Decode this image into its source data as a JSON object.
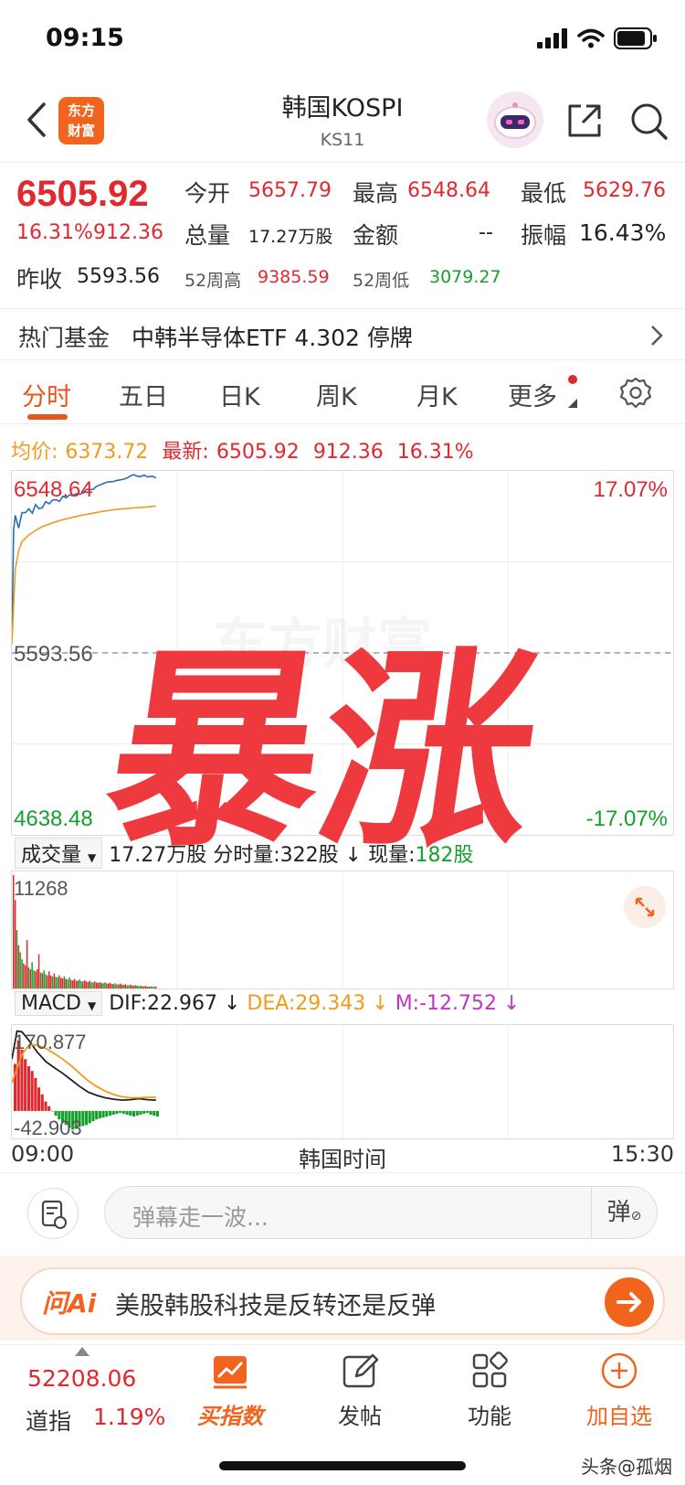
{
  "status_bar": {
    "time": "09:15"
  },
  "nav": {
    "logo_text_1": "东方",
    "logo_text_2": "财富",
    "title": "韩国KOSPI",
    "code": "KS11"
  },
  "quote": {
    "price": "6505.92",
    "change_pct": "16.31%",
    "change": "912.36",
    "open_label": "今开",
    "open": "5657.79",
    "high_label": "最高",
    "high": "6548.64",
    "low_label": "最低",
    "low": "5629.76",
    "volume_label": "总量",
    "volume": "17.27万股",
    "amount_label": "金额",
    "amount": "--",
    "amplitude_label": "振幅",
    "amplitude": "16.43%",
    "prev_close_label": "昨收",
    "prev_close": "5593.56",
    "w52_high_label": "52周高",
    "w52_high": "9385.59",
    "w52_low_label": "52周低",
    "w52_low": "3079.27"
  },
  "fund": {
    "label": "热门基金",
    "text": "中韩半导体ETF 4.302 停牌"
  },
  "tabs": [
    {
      "label": "分时"
    },
    {
      "label": "五日"
    },
    {
      "label": "日K"
    },
    {
      "label": "周K"
    },
    {
      "label": "月K"
    },
    {
      "label": "更多"
    }
  ],
  "info_line": {
    "avg_label": "均价:",
    "avg": "6373.72",
    "latest_label": "最新:",
    "latest": "6505.92",
    "change": "912.36",
    "pct": "16.31%"
  },
  "overlay_text": "暴涨",
  "watermark_text": "东方财富",
  "chart_data": [
    {
      "type": "line",
      "name": "分时",
      "y_labels": {
        "top": "6548.64",
        "middle": "5593.56",
        "bottom": "4638.48"
      },
      "pct_labels": {
        "top": "17.07%",
        "bottom": "-17.07%"
      },
      "ylim": [
        4638.48,
        6548.64
      ],
      "baseline": 5593.56,
      "x_range_minutes": [
        0,
        390
      ],
      "series": [
        {
          "name": "最新",
          "color": "#2a6cb8",
          "points": [
            [
              0,
              5657.8
            ],
            [
              1,
              6250
            ],
            [
              2,
              6330
            ],
            [
              4,
              6262
            ],
            [
              6,
              6345
            ],
            [
              8,
              6345
            ],
            [
              10,
              6365
            ],
            [
              12,
              6342
            ],
            [
              14,
              6388
            ],
            [
              16,
              6366
            ],
            [
              18,
              6372
            ],
            [
              20,
              6404
            ],
            [
              22,
              6392
            ],
            [
              24,
              6412
            ],
            [
              26,
              6414
            ],
            [
              28,
              6404
            ],
            [
              30,
              6432
            ],
            [
              32,
              6424
            ],
            [
              34,
              6440
            ],
            [
              36,
              6436
            ],
            [
              38,
              6446
            ],
            [
              40,
              6443
            ],
            [
              42,
              6450
            ],
            [
              44,
              6470
            ],
            [
              46,
              6468
            ],
            [
              48,
              6470
            ],
            [
              50,
              6486
            ],
            [
              52,
              6494
            ],
            [
              54,
              6500
            ],
            [
              56,
              6508
            ],
            [
              58,
              6510
            ],
            [
              60,
              6512
            ],
            [
              62,
              6518
            ],
            [
              64,
              6520
            ],
            [
              66,
              6524
            ],
            [
              68,
              6530
            ],
            [
              70,
              6542
            ],
            [
              72,
              6548
            ],
            [
              74,
              6540
            ],
            [
              76,
              6538
            ],
            [
              78,
              6546
            ],
            [
              80,
              6536
            ],
            [
              83,
              6540
            ],
            [
              85,
              6530
            ]
          ]
        },
        {
          "name": "均价",
          "color": "#f29a1c",
          "points": [
            [
              0,
              5640
            ],
            [
              2,
              6040
            ],
            [
              4,
              6140
            ],
            [
              6,
              6190
            ],
            [
              10,
              6225
            ],
            [
              14,
              6250
            ],
            [
              18,
              6270
            ],
            [
              24,
              6290
            ],
            [
              30,
              6307
            ],
            [
              36,
              6320
            ],
            [
              42,
              6332
            ],
            [
              48,
              6342
            ],
            [
              54,
              6352
            ],
            [
              60,
              6360
            ],
            [
              66,
              6366
            ],
            [
              72,
              6370
            ],
            [
              78,
              6374
            ],
            [
              85,
              6380
            ]
          ]
        }
      ]
    },
    {
      "type": "bar",
      "name": "成交量",
      "label": "成交量",
      "total": "17.27万股",
      "period_label": "分时量:",
      "period": "322股",
      "current_label": "现量:",
      "current": "182股",
      "ymax_label": "11268",
      "ylim": [
        0,
        11268
      ],
      "values": [
        11268,
        8800,
        5800,
        4300,
        3600,
        2900,
        2500,
        2300,
        4800,
        2100,
        1900,
        2600,
        1800,
        1700,
        1900,
        3400,
        1600,
        1500,
        1800,
        1400,
        1300,
        1700,
        1300,
        1200,
        1500,
        1150,
        1100,
        1300,
        1050,
        1000,
        1200,
        950,
        900,
        1100,
        850,
        800,
        950,
        780,
        760,
        900,
        720,
        700,
        820,
        680,
        650,
        760,
        620,
        600,
        700,
        580,
        560,
        640,
        540,
        520,
        600,
        500,
        480,
        560,
        460,
        440,
        520,
        420,
        400,
        480,
        380,
        360,
        430,
        340,
        320,
        380,
        300,
        280,
        340,
        260,
        240,
        300,
        220,
        200,
        260,
        190,
        180,
        220,
        170,
        160,
        200
      ],
      "colors_pattern": [
        "#e0282e",
        "#e0282e",
        "#16a02b",
        "#e0282e",
        "#16a02b",
        "#16a02b",
        "#e0282e"
      ]
    },
    {
      "type": "line",
      "name": "MACD",
      "label": "MACD",
      "dif": "DIF:22.967",
      "dea": "DEA:29.343",
      "m": "M:-12.752",
      "ymax_label": "170.877",
      "ymin_label": "-42.903",
      "ylim": [
        -42.903,
        170.877
      ],
      "series": [
        {
          "name": "DIF",
          "color": "#222222",
          "points": [
            [
              0,
              110
            ],
            [
              3,
              170
            ],
            [
              6,
              168
            ],
            [
              10,
              150
            ],
            [
              15,
              125
            ],
            [
              20,
              105
            ],
            [
              25,
              92
            ],
            [
              30,
              80
            ],
            [
              35,
              66
            ],
            [
              40,
              52
            ],
            [
              45,
              40
            ],
            [
              50,
              33
            ],
            [
              55,
              28
            ],
            [
              60,
              25
            ],
            [
              65,
              23
            ],
            [
              70,
              24
            ],
            [
              75,
              26
            ],
            [
              80,
              24
            ],
            [
              85,
              23
            ]
          ]
        },
        {
          "name": "DEA",
          "color": "#f29a1c",
          "points": [
            [
              0,
              60
            ],
            [
              3,
              90
            ],
            [
              6,
              120
            ],
            [
              10,
              140
            ],
            [
              15,
              140
            ],
            [
              20,
              133
            ],
            [
              25,
              122
            ],
            [
              30,
              110
            ],
            [
              35,
              96
            ],
            [
              40,
              80
            ],
            [
              45,
              64
            ],
            [
              50,
              52
            ],
            [
              55,
              42
            ],
            [
              60,
              35
            ],
            [
              65,
              30
            ],
            [
              70,
              28
            ],
            [
              75,
              28
            ],
            [
              80,
              29
            ],
            [
              85,
              29
            ]
          ]
        }
      ],
      "m_bars": [
        100,
        150,
        130,
        110,
        95,
        85,
        70,
        50,
        35,
        20,
        10,
        0,
        -10,
        -18,
        -24,
        -30,
        -36,
        -40,
        -38,
        -34,
        -32,
        -30,
        -26,
        -22,
        -18,
        -16,
        -14,
        -12,
        -10,
        -8,
        -6,
        -4,
        -6,
        -8,
        -10,
        -12,
        -10,
        -8,
        -6,
        -4,
        -8,
        -10,
        -12
      ]
    }
  ],
  "time_axis": {
    "start": "09:00",
    "middle": "韩国时间",
    "end": "15:30"
  },
  "comment": {
    "placeholder": "弹幕走一波...",
    "danmaku_label": "弹"
  },
  "ai_bar": {
    "logo": "问Ai",
    "text": "美股韩股科技是反转还是反弹"
  },
  "bottom_nav": {
    "dow_value": "52208.06",
    "dow_name": "道指",
    "dow_pct": "1.19%",
    "items": [
      {
        "label": "买指数"
      },
      {
        "label": "发帖"
      },
      {
        "label": "功能"
      },
      {
        "label": "加自选"
      }
    ]
  },
  "source_watermark": "头条@孤烟"
}
